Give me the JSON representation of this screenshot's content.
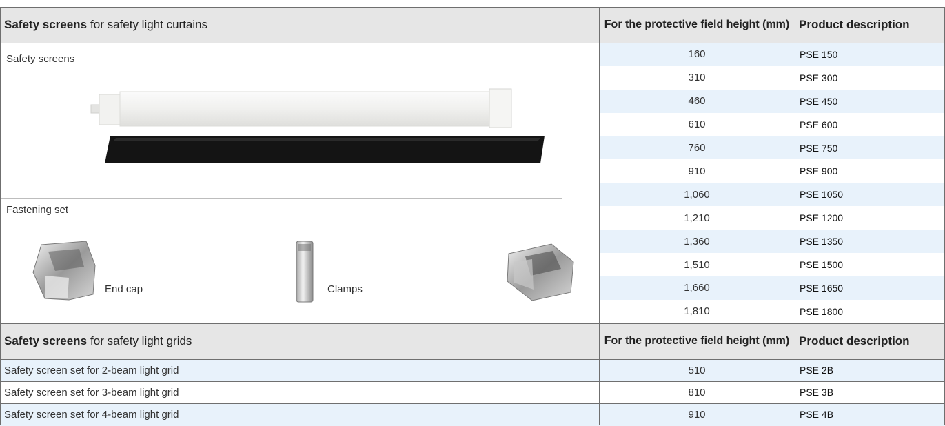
{
  "section1": {
    "title_bold": "Safety screens",
    "title_rest": "for safety light curtains",
    "col_height": "For the protective field height (mm)",
    "col_desc": "Product description",
    "label_screens": "Safety screens",
    "label_fastening": "Fastening set",
    "label_endcap": "End cap",
    "label_clamps": "Clamps",
    "rows": [
      {
        "height": "160",
        "desc": "PSE 150"
      },
      {
        "height": "310",
        "desc": "PSE 300"
      },
      {
        "height": "460",
        "desc": "PSE 450"
      },
      {
        "height": "610",
        "desc": "PSE 600"
      },
      {
        "height": "760",
        "desc": "PSE 750"
      },
      {
        "height": "910",
        "desc": "PSE 900"
      },
      {
        "height": "1,060",
        "desc": "PSE 1050"
      },
      {
        "height": "1,210",
        "desc": "PSE 1200"
      },
      {
        "height": "1,360",
        "desc": "PSE 1350"
      },
      {
        "height": "1,510",
        "desc": "PSE 1500"
      },
      {
        "height": "1,660",
        "desc": "PSE 1650"
      },
      {
        "height": "1,810",
        "desc": "PSE 1800"
      }
    ]
  },
  "section2": {
    "title_bold": "Safety screens",
    "title_rest": "for safety light grids",
    "col_height": "For the protective field height (mm)",
    "col_desc": "Product description",
    "rows": [
      {
        "label": "Safety screen set for 2-beam light grid",
        "height": "510",
        "desc": "PSE 2B"
      },
      {
        "label": "Safety screen set for 3-beam light grid",
        "height": "810",
        "desc": "PSE 3B"
      },
      {
        "label": "Safety screen set for 4-beam light grid",
        "height": "910",
        "desc": "PSE 4B"
      }
    ]
  },
  "colors": {
    "header_bg": "#e6e6e6",
    "row_alt_bg": "#e8f2fb",
    "grid_line": "#6f6f6f"
  }
}
